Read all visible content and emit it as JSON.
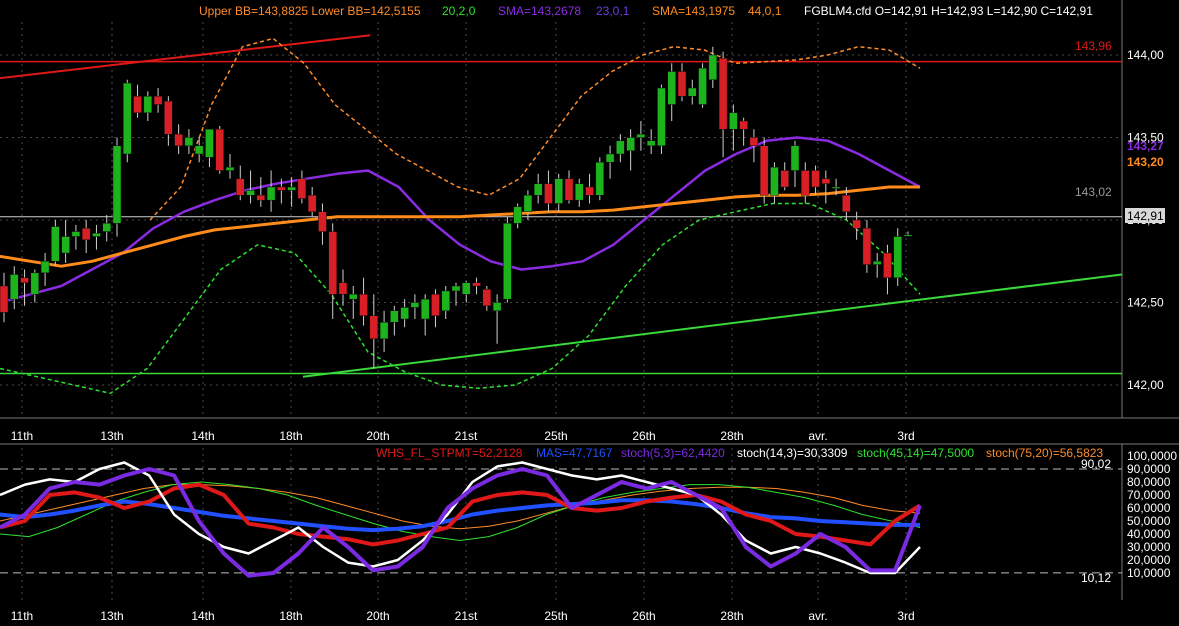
{
  "header": {
    "bb_label": "Upper BB=143,8825 Lower BB=142,5155",
    "bb_params": "20,2,0",
    "sma1_label": "SMA=143,2678",
    "sma1_params": "23,0,1",
    "sma2_label": "SMA=143,1975",
    "sma2_params": "44,0,1",
    "ohlc": "FGBLM4.cfd O=142,91 H=142,93 L=142,90 C=142,91"
  },
  "price_panel": {
    "level_high_label": "143,96",
    "level_mid_label": "143,02",
    "sma1_value_label": "143,27",
    "sma2_value_label": "143,20",
    "last_price_label": "142,91"
  },
  "osc_header": {
    "whs_label": "WHS_FL_STPMT=52,2128",
    "mas_label": "MAS=47,7167",
    "stoch1_label": "stoch(5,3)=62,4420",
    "stoch2_label": "stoch(14,3)=30,3309",
    "stoch3_label": "stoch(45,14)=47,5000",
    "stoch4_label": "stoch(75,20)=56,5823",
    "upper_level_label": "90,02",
    "lower_level_label": "10,12"
  },
  "colors": {
    "background": "#000000",
    "grid": "#4a4a4a",
    "up_candle": "#1db31d",
    "down_candle": "#d81f26",
    "bb_upper": "#ff8c2a",
    "bb_lower": "#2ee02e",
    "sma23": "#8a2be2",
    "sma44": "#ff8c1a",
    "resistance": "#e01818",
    "support": "#3ad83a"
  },
  "chart_data": [
    {
      "type": "candlestick",
      "x_dates": [
        "11th",
        "13th",
        "14th",
        "18th",
        "20th",
        "21st",
        "25th",
        "26th",
        "28th",
        "avr.",
        "3rd"
      ],
      "ylim": [
        141.8,
        144.2
      ],
      "y_ticks": [
        "144,00",
        "143,50",
        "143,00",
        "142,50",
        "142,00"
      ],
      "y_tick_values": [
        144.0,
        143.5,
        143.0,
        142.5,
        142.0
      ],
      "candles": [
        {
          "o": 142.6,
          "h": 142.68,
          "l": 142.38,
          "c": 142.44
        },
        {
          "o": 142.52,
          "h": 142.72,
          "l": 142.46,
          "c": 142.67
        },
        {
          "o": 142.65,
          "h": 142.7,
          "l": 142.48,
          "c": 142.62
        },
        {
          "o": 142.55,
          "h": 142.7,
          "l": 142.5,
          "c": 142.68
        },
        {
          "o": 142.68,
          "h": 142.8,
          "l": 142.6,
          "c": 142.75
        },
        {
          "o": 142.75,
          "h": 143.0,
          "l": 142.72,
          "c": 142.96
        },
        {
          "o": 142.8,
          "h": 143.0,
          "l": 142.74,
          "c": 142.9
        },
        {
          "o": 142.9,
          "h": 142.97,
          "l": 142.82,
          "c": 142.93
        },
        {
          "o": 142.95,
          "h": 143.0,
          "l": 142.8,
          "c": 142.88
        },
        {
          "o": 142.9,
          "h": 142.97,
          "l": 142.82,
          "c": 142.92
        },
        {
          "o": 142.93,
          "h": 143.03,
          "l": 142.87,
          "c": 142.98
        },
        {
          "o": 142.98,
          "h": 143.5,
          "l": 142.9,
          "c": 143.45
        },
        {
          "o": 143.4,
          "h": 143.85,
          "l": 143.35,
          "c": 143.83
        },
        {
          "o": 143.75,
          "h": 143.82,
          "l": 143.62,
          "c": 143.65
        },
        {
          "o": 143.65,
          "h": 143.78,
          "l": 143.6,
          "c": 143.75
        },
        {
          "o": 143.75,
          "h": 143.8,
          "l": 143.65,
          "c": 143.7
        },
        {
          "o": 143.72,
          "h": 143.75,
          "l": 143.45,
          "c": 143.52
        },
        {
          "o": 143.52,
          "h": 143.58,
          "l": 143.4,
          "c": 143.45
        },
        {
          "o": 143.45,
          "h": 143.55,
          "l": 143.4,
          "c": 143.5
        },
        {
          "o": 143.4,
          "h": 143.5,
          "l": 143.35,
          "c": 143.45
        },
        {
          "o": 143.38,
          "h": 143.55,
          "l": 143.32,
          "c": 143.55
        },
        {
          "o": 143.55,
          "h": 143.57,
          "l": 143.28,
          "c": 143.3
        },
        {
          "o": 143.3,
          "h": 143.4,
          "l": 143.25,
          "c": 143.32
        },
        {
          "o": 143.25,
          "h": 143.33,
          "l": 143.12,
          "c": 143.15
        },
        {
          "o": 143.15,
          "h": 143.3,
          "l": 143.1,
          "c": 143.18
        },
        {
          "o": 143.15,
          "h": 143.26,
          "l": 143.08,
          "c": 143.12
        },
        {
          "o": 143.12,
          "h": 143.3,
          "l": 143.05,
          "c": 143.2
        },
        {
          "o": 143.2,
          "h": 143.25,
          "l": 143.1,
          "c": 143.18
        },
        {
          "o": 143.18,
          "h": 143.26,
          "l": 143.08,
          "c": 143.2
        },
        {
          "o": 143.25,
          "h": 143.3,
          "l": 143.1,
          "c": 143.13
        },
        {
          "o": 143.15,
          "h": 143.2,
          "l": 143.02,
          "c": 143.05
        },
        {
          "o": 143.05,
          "h": 143.1,
          "l": 142.85,
          "c": 142.93
        },
        {
          "o": 142.93,
          "h": 142.98,
          "l": 142.4,
          "c": 142.55
        },
        {
          "o": 142.62,
          "h": 142.7,
          "l": 142.48,
          "c": 142.55
        },
        {
          "o": 142.52,
          "h": 142.6,
          "l": 142.4,
          "c": 142.55
        },
        {
          "o": 142.55,
          "h": 142.65,
          "l": 142.36,
          "c": 142.42
        },
        {
          "o": 142.42,
          "h": 142.55,
          "l": 142.1,
          "c": 142.28
        },
        {
          "o": 142.28,
          "h": 142.45,
          "l": 142.2,
          "c": 142.38
        },
        {
          "o": 142.38,
          "h": 142.48,
          "l": 142.3,
          "c": 142.45
        },
        {
          "o": 142.4,
          "h": 142.52,
          "l": 142.35,
          "c": 142.47
        },
        {
          "o": 142.47,
          "h": 142.55,
          "l": 142.4,
          "c": 142.5
        },
        {
          "o": 142.4,
          "h": 142.55,
          "l": 142.3,
          "c": 142.52
        },
        {
          "o": 142.55,
          "h": 142.58,
          "l": 142.35,
          "c": 142.42
        },
        {
          "o": 142.45,
          "h": 142.6,
          "l": 142.4,
          "c": 142.57
        },
        {
          "o": 142.57,
          "h": 142.62,
          "l": 142.48,
          "c": 142.6
        },
        {
          "o": 142.55,
          "h": 142.63,
          "l": 142.5,
          "c": 142.62
        },
        {
          "o": 142.62,
          "h": 142.65,
          "l": 142.55,
          "c": 142.6
        },
        {
          "o": 142.58,
          "h": 142.6,
          "l": 142.45,
          "c": 142.48
        },
        {
          "o": 142.45,
          "h": 142.55,
          "l": 142.25,
          "c": 142.5
        },
        {
          "o": 142.52,
          "h": 143.02,
          "l": 142.5,
          "c": 142.98
        },
        {
          "o": 142.98,
          "h": 143.1,
          "l": 142.95,
          "c": 143.08
        },
        {
          "o": 143.05,
          "h": 143.18,
          "l": 143.0,
          "c": 143.15
        },
        {
          "o": 143.15,
          "h": 143.28,
          "l": 143.1,
          "c": 143.22
        },
        {
          "o": 143.22,
          "h": 143.3,
          "l": 143.05,
          "c": 143.1
        },
        {
          "o": 143.1,
          "h": 143.28,
          "l": 143.05,
          "c": 143.25
        },
        {
          "o": 143.25,
          "h": 143.3,
          "l": 143.1,
          "c": 143.12
        },
        {
          "o": 143.12,
          "h": 143.25,
          "l": 143.08,
          "c": 143.22
        },
        {
          "o": 143.2,
          "h": 143.28,
          "l": 143.1,
          "c": 143.15
        },
        {
          "o": 143.15,
          "h": 143.38,
          "l": 143.12,
          "c": 143.35
        },
        {
          "o": 143.35,
          "h": 143.45,
          "l": 143.25,
          "c": 143.4
        },
        {
          "o": 143.4,
          "h": 143.52,
          "l": 143.35,
          "c": 143.48
        },
        {
          "o": 143.42,
          "h": 143.55,
          "l": 143.3,
          "c": 143.5
        },
        {
          "o": 143.5,
          "h": 143.6,
          "l": 143.42,
          "c": 143.52
        },
        {
          "o": 143.45,
          "h": 143.55,
          "l": 143.4,
          "c": 143.48
        },
        {
          "o": 143.45,
          "h": 143.82,
          "l": 143.4,
          "c": 143.8
        },
        {
          "o": 143.7,
          "h": 143.95,
          "l": 143.6,
          "c": 143.9
        },
        {
          "o": 143.9,
          "h": 143.95,
          "l": 143.72,
          "c": 143.75
        },
        {
          "o": 143.75,
          "h": 143.85,
          "l": 143.7,
          "c": 143.8
        },
        {
          "o": 143.7,
          "h": 143.95,
          "l": 143.68,
          "c": 143.92
        },
        {
          "o": 143.85,
          "h": 144.05,
          "l": 143.8,
          "c": 144.0
        },
        {
          "o": 143.98,
          "h": 144.02,
          "l": 143.38,
          "c": 143.55
        },
        {
          "o": 143.55,
          "h": 143.7,
          "l": 143.42,
          "c": 143.65
        },
        {
          "o": 143.6,
          "h": 143.62,
          "l": 143.45,
          "c": 143.55
        },
        {
          "o": 143.5,
          "h": 143.55,
          "l": 143.35,
          "c": 143.45
        },
        {
          "o": 143.45,
          "h": 143.5,
          "l": 143.1,
          "c": 143.15
        },
        {
          "o": 143.15,
          "h": 143.35,
          "l": 143.1,
          "c": 143.32
        },
        {
          "o": 143.3,
          "h": 143.35,
          "l": 143.18,
          "c": 143.2
        },
        {
          "o": 143.3,
          "h": 143.48,
          "l": 143.2,
          "c": 143.45
        },
        {
          "o": 143.3,
          "h": 143.35,
          "l": 143.1,
          "c": 143.15
        },
        {
          "o": 143.3,
          "h": 143.33,
          "l": 143.15,
          "c": 143.2
        },
        {
          "o": 143.25,
          "h": 143.3,
          "l": 143.1,
          "c": 143.22
        },
        {
          "o": 143.2,
          "h": 143.25,
          "l": 143.15,
          "c": 143.2
        },
        {
          "o": 143.15,
          "h": 143.2,
          "l": 143.0,
          "c": 143.05
        },
        {
          "o": 143.0,
          "h": 143.05,
          "l": 142.88,
          "c": 142.95
        },
        {
          "o": 142.95,
          "h": 143.0,
          "l": 142.68,
          "c": 142.73
        },
        {
          "o": 142.73,
          "h": 142.8,
          "l": 142.65,
          "c": 142.75
        },
        {
          "o": 142.8,
          "h": 142.85,
          "l": 142.55,
          "c": 142.65
        },
        {
          "o": 142.65,
          "h": 142.95,
          "l": 142.6,
          "c": 142.9
        },
        {
          "o": 142.91,
          "h": 142.93,
          "l": 142.9,
          "c": 142.91
        }
      ],
      "lines": {
        "resistance": {
          "y": 143.96,
          "x_range": [
            0,
            1.0
          ]
        },
        "horizontal_1": {
          "y": 143.02
        },
        "support_horizontal": {
          "y": 142.07
        },
        "trend_up_red": {
          "points": [
            [
              0,
              143.86
            ],
            [
              0.33,
              144.12
            ]
          ]
        },
        "trend_up_green": {
          "points": [
            [
              0.27,
              142.05
            ],
            [
              1.0,
              142.67
            ]
          ]
        }
      },
      "series": [
        {
          "name": "SMA(23)",
          "values": [
            142.5,
            142.55,
            142.6,
            142.7,
            142.8,
            142.95,
            143.05,
            143.12,
            143.18,
            143.22,
            143.25,
            143.28,
            143.3,
            143.2,
            143.0,
            142.85,
            142.75,
            142.7,
            142.72,
            142.75,
            142.85,
            143.0,
            143.15,
            143.3,
            143.4,
            143.48,
            143.5,
            143.48,
            143.4,
            143.3,
            143.2
          ]
        },
        {
          "name": "SMA(44)",
          "values": [
            142.78,
            142.75,
            142.72,
            142.75,
            142.8,
            142.85,
            142.9,
            142.94,
            142.96,
            142.98,
            143.0,
            143.02,
            143.02,
            143.02,
            143.02,
            143.02,
            143.03,
            143.04,
            143.05,
            143.05,
            143.06,
            143.08,
            143.1,
            143.12,
            143.14,
            143.15,
            143.15,
            143.16,
            143.18,
            143.2,
            143.2
          ]
        },
        {
          "name": "BB upper",
          "values": [
            143.0,
            143.2,
            143.7,
            144.05,
            144.1,
            143.95,
            143.7,
            143.55,
            143.4,
            143.3,
            143.2,
            143.15,
            143.25,
            143.5,
            143.75,
            143.9,
            144.0,
            144.05,
            144.03,
            143.95,
            143.96,
            143.97,
            144.0,
            144.05,
            144.03,
            143.92
          ]
        },
        {
          "name": "BB lower",
          "values": [
            142.1,
            142.05,
            142.0,
            141.95,
            142.1,
            142.4,
            142.7,
            142.85,
            142.8,
            142.55,
            142.2,
            142.08,
            142.0,
            141.98,
            142.0,
            142.1,
            142.3,
            142.6,
            142.85,
            143.0,
            143.05,
            143.1,
            143.1,
            143.0,
            142.8,
            142.55
          ]
        }
      ]
    },
    {
      "type": "line",
      "ylim": [
        0,
        100
      ],
      "y_ticks": [
        "100,0000",
        "90,0000",
        "80,0000",
        "70,0000",
        "60,0000",
        "50,0000",
        "40,0000",
        "30,0000",
        "20,0000",
        "10,0000"
      ],
      "y_tick_values": [
        100,
        90,
        80,
        70,
        60,
        50,
        40,
        30,
        20,
        10
      ],
      "upper_level": 90.02,
      "lower_level": 10.12,
      "series": [
        {
          "name": "WHS_FL_STPMT",
          "values": [
            45,
            50,
            70,
            72,
            68,
            60,
            65,
            75,
            78,
            70,
            48,
            45,
            40,
            38,
            36,
            32,
            35,
            40,
            45,
            65,
            70,
            72,
            70,
            60,
            58,
            60,
            65,
            68,
            70,
            65,
            55,
            50,
            40,
            38,
            35,
            32,
            50,
            62
          ]
        },
        {
          "name": "MAS",
          "values": [
            55,
            53,
            55,
            58,
            62,
            65,
            63,
            60,
            57,
            54,
            52,
            50,
            48,
            46,
            44,
            43,
            44,
            46,
            50,
            55,
            58,
            60,
            62,
            63,
            64,
            66,
            66,
            65,
            63,
            60,
            56,
            53,
            52,
            50,
            49,
            48,
            47,
            47
          ]
        },
        {
          "name": "stoch(5,3)",
          "values": [
            45,
            55,
            75,
            80,
            78,
            85,
            90,
            85,
            50,
            25,
            8,
            10,
            25,
            45,
            30,
            12,
            15,
            30,
            60,
            75,
            85,
            90,
            85,
            60,
            70,
            80,
            75,
            80,
            70,
            60,
            30,
            15,
            25,
            40,
            30,
            12,
            12,
            62
          ]
        },
        {
          "name": "stoch(14,3)",
          "values": [
            70,
            78,
            82,
            80,
            90,
            95,
            85,
            55,
            40,
            30,
            25,
            35,
            45,
            30,
            18,
            15,
            20,
            35,
            55,
            80,
            92,
            95,
            90,
            85,
            82,
            85,
            80,
            75,
            70,
            55,
            35,
            25,
            30,
            25,
            18,
            10,
            10,
            30
          ]
        },
        {
          "name": "stoch(45,14)",
          "values": [
            40,
            38,
            45,
            55,
            65,
            72,
            78,
            80,
            78,
            75,
            70,
            62,
            55,
            48,
            42,
            38,
            35,
            38,
            45,
            55,
            62,
            68,
            72,
            75,
            78,
            78,
            76,
            72,
            68,
            62,
            55,
            50,
            45
          ]
        },
        {
          "name": "stoch(75,20)",
          "values": [
            50,
            55,
            60,
            65,
            70,
            75,
            78,
            78,
            77,
            75,
            72,
            68,
            62,
            56,
            50,
            46,
            44,
            46,
            50,
            56,
            62,
            66,
            70,
            73,
            75,
            76,
            76,
            75,
            72,
            68,
            62,
            58,
            56
          ]
        }
      ]
    }
  ]
}
